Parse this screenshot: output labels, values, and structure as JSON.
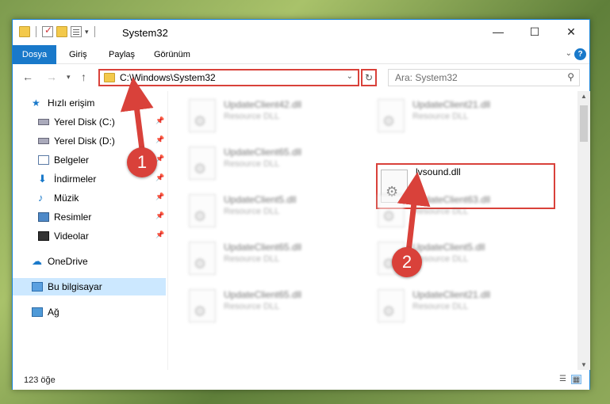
{
  "window": {
    "title": "System32",
    "controls": {
      "minimize": "—",
      "maximize": "☐",
      "close": "✕"
    }
  },
  "ribbon": {
    "tabs": [
      "Dosya",
      "Giriş",
      "Paylaş",
      "Görünüm"
    ],
    "help": "?"
  },
  "address": {
    "path": "C:\\Windows\\System32",
    "search_placeholder": "Ara: System32"
  },
  "sidebar": {
    "items": [
      {
        "label": "Hızlı erişim",
        "icon": "star-icon",
        "pinned": false
      },
      {
        "label": "Yerel Disk (C:)",
        "icon": "drive-icon",
        "pinned": true
      },
      {
        "label": "Yerel Disk (D:)",
        "icon": "drive-icon",
        "pinned": true
      },
      {
        "label": "Belgeler",
        "icon": "documents-icon",
        "pinned": true
      },
      {
        "label": "İndirmeler",
        "icon": "download-icon",
        "pinned": true
      },
      {
        "label": "Müzik",
        "icon": "music-icon",
        "pinned": true
      },
      {
        "label": "Resimler",
        "icon": "pictures-icon",
        "pinned": true
      },
      {
        "label": "Videolar",
        "icon": "videos-icon",
        "pinned": true
      },
      {
        "label": "OneDrive",
        "icon": "cloud-icon",
        "pinned": false
      },
      {
        "label": "Bu bilgisayar",
        "icon": "computer-icon",
        "pinned": false,
        "selected": true
      },
      {
        "label": "Ağ",
        "icon": "network-icon",
        "pinned": false
      }
    ]
  },
  "files": [
    {
      "name": "UpdateClient42.dll",
      "type": "Resource DLL"
    },
    {
      "name": "UpdateClient21.dll",
      "type": "Resource DLL"
    },
    {
      "name": "UpdateClient65.dll",
      "type": "Resource DLL"
    },
    {
      "name": "lvsound.dll",
      "type": ""
    },
    {
      "name": "UpdateClient5.dll",
      "type": "Resource DLL"
    },
    {
      "name": "UpdateClient63.dll",
      "type": "Resource DLL"
    },
    {
      "name": "UpdateClient65.dll",
      "type": "Resource DLL"
    },
    {
      "name": "UpdateClient5.dll",
      "type": "Resource DLL"
    },
    {
      "name": "UpdateClient65.dll",
      "type": "Resource DLL"
    },
    {
      "name": "UpdateClient21.dll",
      "type": "Resource DLL"
    }
  ],
  "status": {
    "count": "123 öğe"
  },
  "annotations": {
    "step1": "1",
    "step2": "2",
    "color": "#d9413a"
  }
}
